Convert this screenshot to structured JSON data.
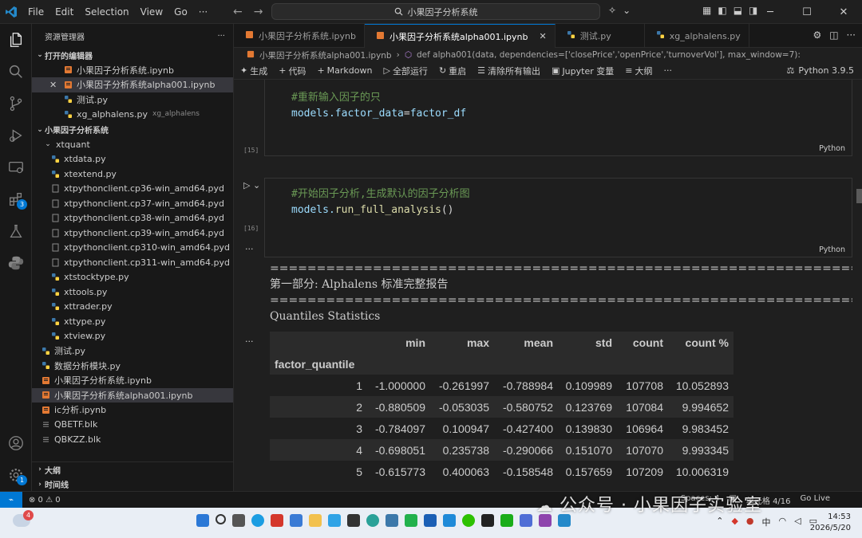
{
  "titlebar": {
    "menu": [
      "File",
      "Edit",
      "Selection",
      "View",
      "Go",
      "···"
    ],
    "search": "小果因子分析系统"
  },
  "sidebar": {
    "title": "资源管理器",
    "open_editors_label": "打开的编辑器",
    "open_editors": [
      {
        "name": "小果因子分析系统.ipynb",
        "icon": "notebook-icon"
      },
      {
        "name": "小果因子分析系统alpha001.ipynb",
        "icon": "notebook-icon",
        "selected": true
      },
      {
        "name": "测试.py",
        "icon": "python-icon"
      },
      {
        "name": "xg_alphalens.py",
        "desc": "xg_alphalens",
        "icon": "python-icon"
      }
    ],
    "project_label": "小果因子分析系统",
    "folder_xtquant": "xtquant",
    "xtquant_files": [
      "xtdata.py",
      "xtextend.py",
      "xtpythonclient.cp36-win_amd64.pyd",
      "xtpythonclient.cp37-win_amd64.pyd",
      "xtpythonclient.cp38-win_amd64.pyd",
      "xtpythonclient.cp39-win_amd64.pyd",
      "xtpythonclient.cp310-win_amd64.pyd",
      "xtpythonclient.cp311-win_amd64.pyd",
      "xtstocktype.py",
      "xttools.py",
      "xttrader.py",
      "xttype.py",
      "xtview.py"
    ],
    "root_files": [
      {
        "name": "测试.py",
        "icon": "python-icon"
      },
      {
        "name": "数据分析模块.py",
        "icon": "python-icon"
      },
      {
        "name": "小果因子分析系统.ipynb",
        "icon": "notebook-icon"
      },
      {
        "name": "小果因子分析系统alpha001.ipynb",
        "icon": "notebook-icon",
        "selected": true
      },
      {
        "name": "ic分析.ipynb",
        "icon": "notebook-icon"
      },
      {
        "name": "QBETF.blk",
        "icon": "file-icon"
      },
      {
        "name": "QBKZZ.blk",
        "icon": "file-icon"
      }
    ],
    "outline_label": "大纲",
    "timeline_label": "时间线"
  },
  "activity_badges": {
    "extensions": "3",
    "settings": "1"
  },
  "tabs": [
    {
      "label": "小果因子分析系统.ipynb",
      "active": false
    },
    {
      "label": "小果因子分析系统alpha001.ipynb",
      "active": true
    },
    {
      "label": "测试.py",
      "active": false
    },
    {
      "label": "xg_alphalens.py",
      "active": false
    }
  ],
  "breadcrumb": {
    "file": "小果因子分析系统alpha001.ipynb",
    "symbol": "def alpha001(data, dependencies=['closePrice','openPrice','turnoverVol'], max_window=7):"
  },
  "toolbar": {
    "generate": "生成",
    "code": "代码",
    "markdown": "Markdown",
    "run_all": "全部运行",
    "restart": "重启",
    "clear": "清除所有输出",
    "jupyter_vars": "Jupyter 变量",
    "outline": "大纲",
    "more": "···",
    "kernel": "Python 3.9.5"
  },
  "cells": [
    {
      "exec": "[15]",
      "comment": "#重新输入因子的只",
      "code_var": "models.factor_data",
      "code_op": "=",
      "code_val": "factor_df",
      "lang": "Python"
    },
    {
      "exec": "[16]",
      "comment": "#开始因子分析,生成默认的因子分析图",
      "code_var": "models.",
      "code_fn": "run_full_analysis",
      "code_tail": "()",
      "lang": "Python"
    }
  ],
  "output": {
    "separator": "==========================================================================",
    "heading": "第一部分: Alphalens 标准完整报告",
    "subheading": "Quantiles Statistics",
    "table": {
      "columns": [
        "min",
        "max",
        "mean",
        "std",
        "count",
        "count %"
      ],
      "index_name": "factor_quantile",
      "rows": [
        {
          "q": "1",
          "min": "-1.000000",
          "max": "-0.261997",
          "mean": "-0.788984",
          "std": "0.109989",
          "count": "107708",
          "pct": "10.052893"
        },
        {
          "q": "2",
          "min": "-0.880509",
          "max": "-0.053035",
          "mean": "-0.580752",
          "std": "0.123769",
          "count": "107084",
          "pct": "9.994652"
        },
        {
          "q": "3",
          "min": "-0.784097",
          "max": "0.100947",
          "mean": "-0.427400",
          "std": "0.139830",
          "count": "106964",
          "pct": "9.983452"
        },
        {
          "q": "4",
          "min": "-0.698051",
          "max": "0.235738",
          "mean": "-0.290066",
          "std": "0.151070",
          "count": "107070",
          "pct": "9.993345"
        },
        {
          "q": "5",
          "min": "-0.615773",
          "max": "0.400063",
          "mean": "-0.158548",
          "std": "0.157659",
          "count": "107209",
          "pct": "10.006319"
        }
      ]
    }
  },
  "statusbar": {
    "problems": "⊗ 0 ⚠ 0",
    "spaces": "Spaces: 4",
    "cell": "单元格 4/16",
    "golive": "Go Live"
  },
  "taskbar": {
    "weather_badge": "4",
    "ime": "中",
    "time": "14:53",
    "date": "2026/5/20"
  },
  "watermark": "公众号 · 小果因子实验室"
}
